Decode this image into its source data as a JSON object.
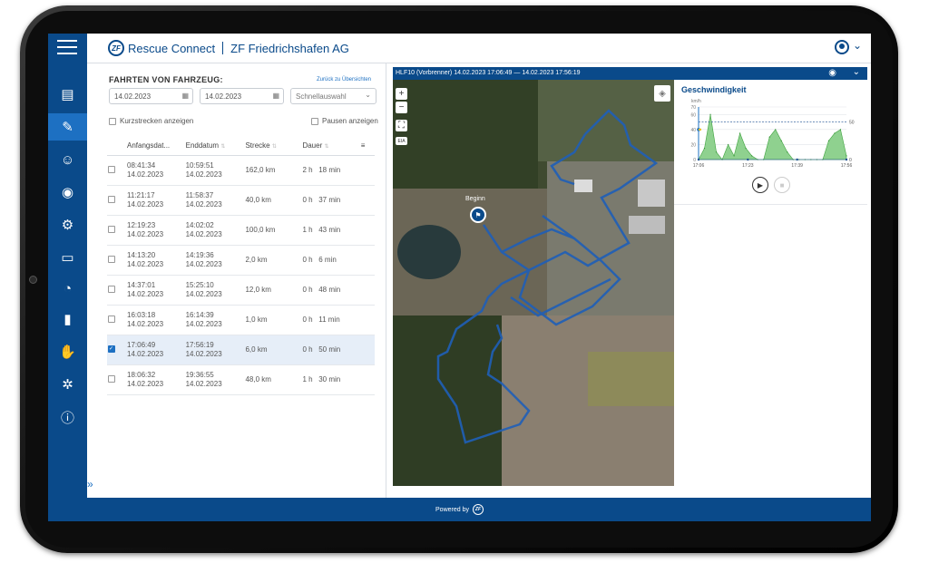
{
  "header": {
    "brand": "Rescue Connect",
    "company": "ZF Friedrichshafen AG",
    "logo_text": "ZF"
  },
  "nav": {
    "icons": [
      "dashboard-icon",
      "trips-icon",
      "driver-icon",
      "vehicle-icon",
      "maintenance-icon",
      "monitor-icon",
      "speedometer-icon",
      "statistics-icon",
      "handshake-icon",
      "settings-icon",
      "info-icon"
    ]
  },
  "panel": {
    "title": "FAHRTEN VON FAHRZEUG:",
    "back_link": "Zurück zu Übersichten",
    "date_from": "14.02.2023",
    "date_to": "14.02.2023",
    "quick_select": "Schnellauswahl",
    "short_trips": "Kurzstrecken anzeigen",
    "pauses": "Pausen anzeigen",
    "columns": {
      "start": "Anfangsdat...",
      "end": "Enddatum",
      "distance": "Strecke",
      "duration": "Dauer"
    },
    "rows": [
      {
        "start_time": "08:41:34",
        "start_date": "14.02.2023",
        "end_time": "10:59:51",
        "end_date": "14.02.2023",
        "distance": "162,0 km",
        "hours": "2 h",
        "minutes": "18 min",
        "selected": false
      },
      {
        "start_time": "11:21:17",
        "start_date": "14.02.2023",
        "end_time": "11:58:37",
        "end_date": "14.02.2023",
        "distance": "40,0 km",
        "hours": "0 h",
        "minutes": "37 min",
        "selected": false
      },
      {
        "start_time": "12:19:23",
        "start_date": "14.02.2023",
        "end_time": "14:02:02",
        "end_date": "14.02.2023",
        "distance": "100,0 km",
        "hours": "1 h",
        "minutes": "43 min",
        "selected": false
      },
      {
        "start_time": "14:13:20",
        "start_date": "14.02.2023",
        "end_time": "14:19:36",
        "end_date": "14.02.2023",
        "distance": "2,0 km",
        "hours": "0 h",
        "minutes": "6 min",
        "selected": false
      },
      {
        "start_time": "14:37:01",
        "start_date": "14.02.2023",
        "end_time": "15:25:10",
        "end_date": "14.02.2023",
        "distance": "12,0 km",
        "hours": "0 h",
        "minutes": "48 min",
        "selected": false
      },
      {
        "start_time": "16:03:18",
        "start_date": "14.02.2023",
        "end_time": "16:14:39",
        "end_date": "14.02.2023",
        "distance": "1,0 km",
        "hours": "0 h",
        "minutes": "11 min",
        "selected": false
      },
      {
        "start_time": "17:06:49",
        "start_date": "14.02.2023",
        "end_time": "17:56:19",
        "end_date": "14.02.2023",
        "distance": "6,0 km",
        "hours": "0 h",
        "minutes": "50 min",
        "selected": true
      },
      {
        "start_time": "18:06:32",
        "start_date": "14.02.2023",
        "end_time": "19:36:55",
        "end_date": "14.02.2023",
        "distance": "48,0 km",
        "hours": "1 h",
        "minutes": "30 min",
        "selected": false
      }
    ]
  },
  "map": {
    "title": "HLF10 (Vorbrenner)   14.02.2023 17:06:49 — 14.02.2023 17:56:19",
    "zoom_in": "+",
    "zoom_out": "−",
    "fullscreen": "⛶",
    "km_label": "EIA",
    "start_label": "Beginn"
  },
  "speed": {
    "title": "Geschwindigkeit",
    "unit": "km/h",
    "y_ticks": [
      "70",
      "60",
      "40",
      "20",
      "0"
    ],
    "right_ticks": [
      "50",
      "0"
    ],
    "x_ticks": [
      "17:06",
      "17:23",
      "17:39",
      "17:56"
    ]
  },
  "chart_data": {
    "type": "area",
    "title": "Geschwindigkeit",
    "ylabel": "km/h",
    "ylim": [
      0,
      70
    ],
    "x": [
      "17:06",
      "17:08",
      "17:10",
      "17:12",
      "17:14",
      "17:16",
      "17:18",
      "17:20",
      "17:22",
      "17:24",
      "17:26",
      "17:28",
      "17:30",
      "17:32",
      "17:34",
      "17:36",
      "17:38",
      "17:40",
      "17:42",
      "17:44",
      "17:46",
      "17:48",
      "17:50",
      "17:52",
      "17:54",
      "17:56"
    ],
    "series": [
      {
        "values": [
          0,
          15,
          60,
          10,
          0,
          20,
          5,
          35,
          15,
          5,
          0,
          0,
          30,
          40,
          25,
          10,
          0,
          0,
          0,
          0,
          0,
          0,
          25,
          35,
          40,
          5
        ]
      }
    ],
    "reference_line": 50,
    "x_ticks": [
      "17:06",
      "17:23",
      "17:39",
      "17:56"
    ]
  },
  "footer": {
    "text": "Powered by",
    "logo_text": "ZF"
  }
}
